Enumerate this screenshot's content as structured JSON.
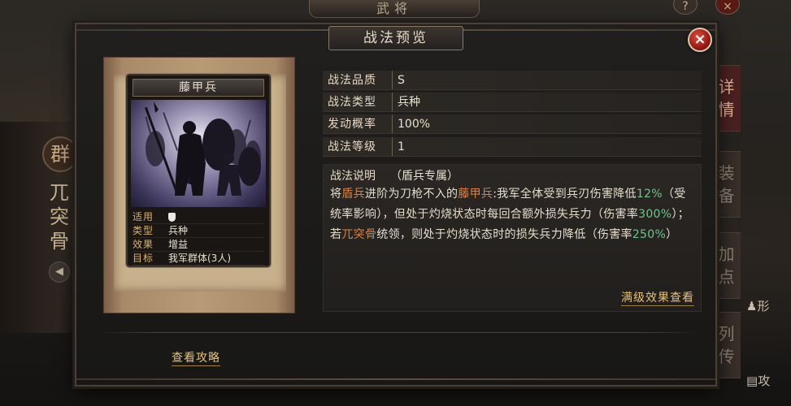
{
  "background": {
    "top_tab": "武将",
    "faction": "群",
    "general_name": "兀突骨",
    "side_tabs": [
      "详情",
      "装备",
      "加点",
      "列传"
    ],
    "side_links": [
      "形",
      "攻"
    ]
  },
  "dialog": {
    "title": "战法预览",
    "close_label": "×"
  },
  "card": {
    "name": "藤甲兵",
    "stats": [
      {
        "key": "适用",
        "value": "",
        "icon": "shield-icon"
      },
      {
        "key": "类型",
        "value": "兵种"
      },
      {
        "key": "效果",
        "value": "增益"
      },
      {
        "key": "目标",
        "value": "我军群体(3人)"
      }
    ]
  },
  "info": {
    "rows": [
      {
        "key": "战法品质",
        "value": "S"
      },
      {
        "key": "战法类型",
        "value": "兵种"
      },
      {
        "key": "发动概率",
        "value": "100%"
      },
      {
        "key": "战法等级",
        "value": "1"
      }
    ]
  },
  "description": {
    "label": "战法说明",
    "tag": "（盾兵专属）",
    "segments": [
      {
        "text": "将",
        "style": ""
      },
      {
        "text": "盾兵",
        "style": "orange"
      },
      {
        "text": "进阶为刀枪不入的",
        "style": ""
      },
      {
        "text": "藤甲兵",
        "style": "orange"
      },
      {
        "text": ":我军全体受到兵刃伤害降低",
        "style": ""
      },
      {
        "text": "12%",
        "style": "green"
      },
      {
        "text": "（受统率影响），但处于灼烧状态时每回合额外损失兵力（伤害率",
        "style": ""
      },
      {
        "text": "300%",
        "style": "green"
      },
      {
        "text": "）；若",
        "style": ""
      },
      {
        "text": "兀突骨",
        "style": "orange"
      },
      {
        "text": "统领，则处于灼烧状态时的损失兵力降低（伤害率",
        "style": ""
      },
      {
        "text": "250%",
        "style": "green"
      },
      {
        "text": "）",
        "style": ""
      }
    ],
    "full_effect_link": "满级效果查看"
  },
  "guide_link": "查看攻略",
  "colors": {
    "highlight_orange": "#e0803a",
    "highlight_green": "#6ec68a",
    "link_gold": "#e8c070",
    "close_red": "#c8281e"
  }
}
